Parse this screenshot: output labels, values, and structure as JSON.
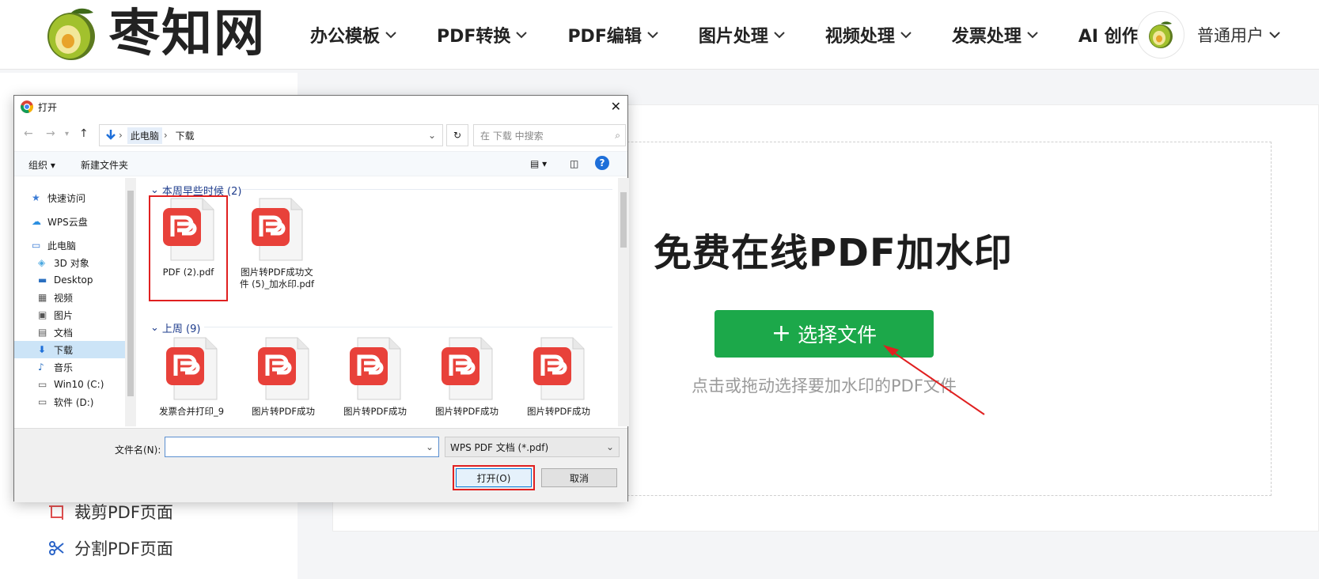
{
  "brand": {
    "name": "枣知网"
  },
  "nav": {
    "items": [
      {
        "label": "办公模板",
        "has_dropdown": true
      },
      {
        "label": "PDF转换",
        "has_dropdown": true
      },
      {
        "label": "PDF编辑",
        "has_dropdown": true
      },
      {
        "label": "图片处理",
        "has_dropdown": true
      },
      {
        "label": "视频处理",
        "has_dropdown": true
      },
      {
        "label": "发票处理",
        "has_dropdown": true
      },
      {
        "label": "AI 创作",
        "has_dropdown": false
      }
    ],
    "user_label": "普通用户"
  },
  "sidebar": {
    "items": [
      {
        "label": "裁剪PDF页面",
        "icon": "crop-icon"
      },
      {
        "label": "分割PDF页面",
        "icon": "scissors-icon"
      }
    ]
  },
  "main": {
    "title": "免费在线PDF加水印",
    "select_button": "选择文件",
    "hint": "点击或拖动选择要加水印的PDF文件",
    "accent_color": "#1ca84a"
  },
  "dialog": {
    "title": "打开",
    "path": [
      "此电脑",
      "下载"
    ],
    "search_placeholder": "在 下载 中搜索",
    "toolbar": {
      "organize": "组织",
      "new_folder": "新建文件夹"
    },
    "tree": [
      {
        "label": "快速访问",
        "icon": "star-icon"
      },
      {
        "label": "WPS云盘",
        "icon": "cloud-icon"
      },
      {
        "label": "此电脑",
        "icon": "computer-icon"
      },
      {
        "label": "3D 对象",
        "icon": "cube-icon"
      },
      {
        "label": "Desktop",
        "icon": "desktop-icon"
      },
      {
        "label": "视频",
        "icon": "video-icon"
      },
      {
        "label": "图片",
        "icon": "picture-icon"
      },
      {
        "label": "文档",
        "icon": "document-icon"
      },
      {
        "label": "下载",
        "icon": "download-icon",
        "selected": true
      },
      {
        "label": "音乐",
        "icon": "music-icon"
      },
      {
        "label": "Win10 (C:)",
        "icon": "drive-icon"
      },
      {
        "label": "软件 (D:)",
        "icon": "drive-icon"
      }
    ],
    "groups": [
      {
        "label": "本周早些时候 (2)",
        "files": [
          {
            "name": "PDF (2).pdf",
            "highlighted": true
          },
          {
            "name": "图片转PDF成功文件 (5)_加水印.pdf"
          }
        ]
      },
      {
        "label": "上周 (9)",
        "files": [
          {
            "name": "发票合并打印_9"
          },
          {
            "name": "图片转PDF成功"
          },
          {
            "name": "图片转PDF成功"
          },
          {
            "name": "图片转PDF成功"
          },
          {
            "name": "图片转PDF成功"
          }
        ]
      }
    ],
    "filename_label": "文件名(N):",
    "filename_value": "",
    "filetype": "WPS PDF 文档 (*.pdf)",
    "open_button": "打开(O)",
    "cancel_button": "取消"
  }
}
